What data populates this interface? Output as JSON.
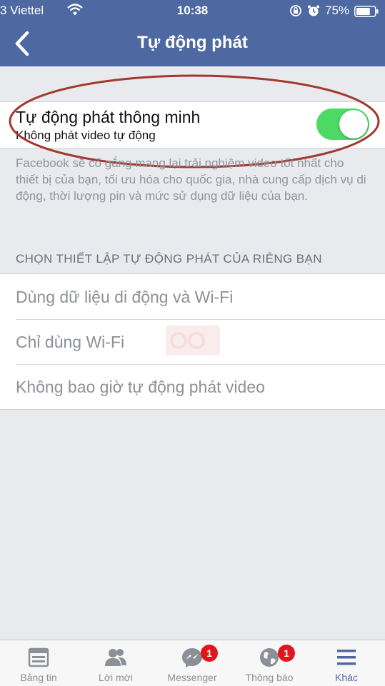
{
  "status_bar": {
    "carrier": "3 Viettel",
    "time": "10:38",
    "battery_percent": "75%",
    "battery_level": 0.75,
    "icons": [
      "wifi-icon",
      "orientation-lock-icon",
      "alarm-icon",
      "battery-icon"
    ]
  },
  "nav": {
    "title": "Tự động phát",
    "back_icon": "chevron-left-icon"
  },
  "smart_autoplay": {
    "title": "Tự động phát thông minh",
    "subtitle": "Không phát video tự động",
    "enabled": true
  },
  "description": "Facebook sẽ cố gắng mang lại trải nghiệm video tốt nhất cho thiết bị của bạn, tối ưu hóa cho quốc gia, nhà cung cấp dịch vụ di động, thời lượng pin và mức sử dụng dữ liệu của bạn.",
  "section_header": "CHỌN THIẾT LẬP TỰ ĐỘNG PHÁT CỦA RIÊNG BẠN",
  "options": [
    {
      "label": "Dùng dữ liệu di động và Wi-Fi"
    },
    {
      "label": "Chỉ dùng Wi-Fi"
    },
    {
      "label": "Không bao giờ tự động phát video"
    }
  ],
  "tabs": [
    {
      "label": "Bảng tin",
      "icon": "news-feed-icon",
      "active": false
    },
    {
      "label": "Lời mời",
      "icon": "friend-requests-icon",
      "active": false
    },
    {
      "label": "Messenger",
      "icon": "messenger-icon",
      "badge": "1",
      "active": false
    },
    {
      "label": "Thông báo",
      "icon": "globe-icon",
      "badge": "1",
      "active": false
    },
    {
      "label": "Khác",
      "icon": "menu-icon",
      "active": true
    }
  ],
  "colors": {
    "header": "#4e69a2",
    "toggle_on": "#4cd964",
    "badge": "#e0161d",
    "annotation": "#a0392e",
    "active_tab": "#4e69a2"
  }
}
